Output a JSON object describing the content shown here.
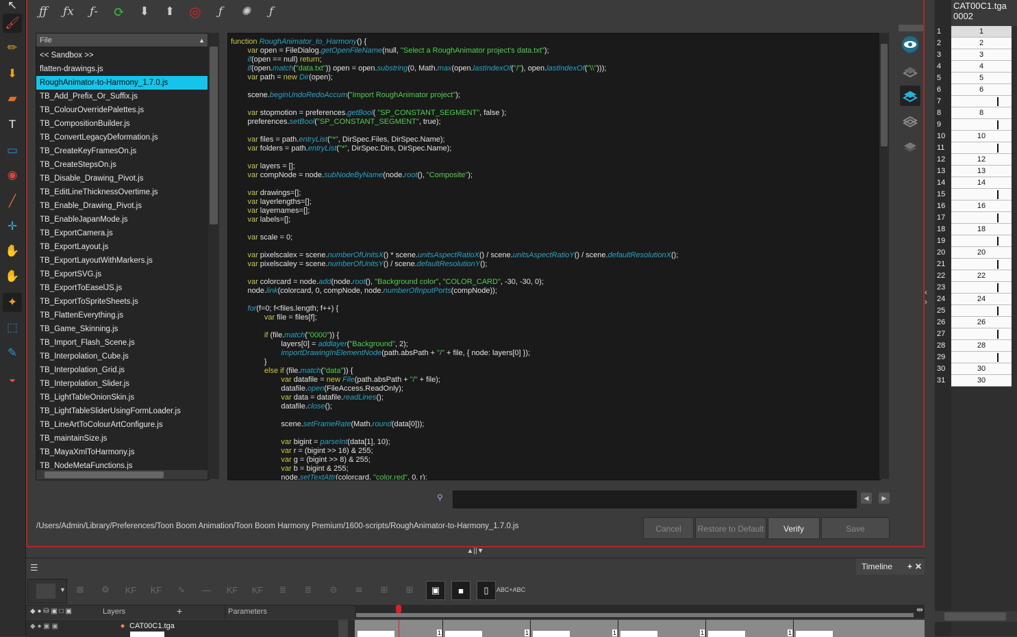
{
  "toolbar_left": {
    "tools": [
      "select-icon",
      "brush-icon",
      "pencil-icon",
      "paint-icon",
      "eraser-icon",
      "text-icon",
      "rectangle-icon",
      "ink-icon",
      "dropper-icon",
      "pivot-icon",
      "hand-icon",
      "zoom-icon",
      "animate-icon",
      "transform-icon",
      "cutter-icon",
      "morph-icon"
    ]
  },
  "script_toolbar": {
    "icons": [
      "manage-functions-icon",
      "new-function-icon",
      "delete-function-icon",
      "refresh-icon",
      "import-script-icon",
      "export-script-icon",
      "target-icon",
      "run-function-icon",
      "debug-icon",
      "set-target-icon"
    ]
  },
  "file_panel": {
    "header": "File",
    "sort_glyph": "▲",
    "files": [
      "<< Sandbox >>",
      "flatten-drawings.js",
      "RoughAnimator-to-Harmony_1.7.0.js",
      "TB_Add_Prefix_Or_Suffix.js",
      "TB_ColourOverridePalettes.js",
      "TB_CompositionBuilder.js",
      "TB_ConvertLegacyDeformation.js",
      "TB_CreateKeyFramesOn.js",
      "TB_CreateStepsOn.js",
      "TB_Disable_Drawing_Pivot.js",
      "TB_EditLineThicknessOvertime.js",
      "TB_Enable_Drawing_Pivot.js",
      "TB_EnableJapanMode.js",
      "TB_ExportCamera.js",
      "TB_ExportLayout.js",
      "TB_ExportLayoutWithMarkers.js",
      "TB_ExportSVG.js",
      "TB_ExportToEaselJS.js",
      "TB_ExportToSpriteSheets.js",
      "TB_FlattenEverything.js",
      "TB_Game_Skinning.js",
      "TB_Import_Flash_Scene.js",
      "TB_Interpolation_Cube.js",
      "TB_Interpolation_Grid.js",
      "TB_Interpolation_Slider.js",
      "TB_LightTableOnionSkin.js",
      "TB_LightTableSliderUsingFormLoader.js",
      "TB_LineArtToColourArtConfigure.js",
      "TB_maintainSize.js",
      "TB_MayaXmlToHarmony.js",
      "TB_NodeMetaFunctions.js"
    ],
    "selected_index": 2
  },
  "code": [
    [
      [
        "kw",
        "function "
      ],
      [
        "fn",
        "RoughAnimator_to_Harmony"
      ],
      [
        "",
        "() {"
      ]
    ],
    [
      [
        "",
        "        "
      ],
      [
        "kw",
        "var "
      ],
      [
        "",
        "open = FileDialog."
      ],
      [
        "fn",
        "getOpenFileName"
      ],
      [
        "",
        "(null, "
      ],
      [
        "st",
        "\"Select a RoughAnimator project's data.txt\""
      ],
      [
        "",
        ");"
      ]
    ],
    [
      [
        "",
        "        "
      ],
      [
        "fn",
        "if"
      ],
      [
        "",
        "(open == null) "
      ],
      [
        "kw",
        "return"
      ],
      [
        "",
        ";"
      ]
    ],
    [
      [
        "",
        "        "
      ],
      [
        "fn",
        "if"
      ],
      [
        "",
        "(open."
      ],
      [
        "fn",
        "match"
      ],
      [
        "",
        "("
      ],
      [
        "st",
        "\"data.txt\""
      ],
      [
        "",
        ")) open = open."
      ],
      [
        "fn",
        "substring"
      ],
      [
        "",
        "(0, Math."
      ],
      [
        "fn",
        "max"
      ],
      [
        "",
        "(open."
      ],
      [
        "fn",
        "lastIndexOf"
      ],
      [
        "",
        "("
      ],
      [
        "st",
        "\"/\""
      ],
      [
        "",
        "), open."
      ],
      [
        "fn",
        "lastIndexOf"
      ],
      [
        "",
        "("
      ],
      [
        "st",
        "\"\\\\\""
      ],
      [
        "",
        ")));"
      ]
    ],
    [
      [
        "",
        "        "
      ],
      [
        "kw",
        "var "
      ],
      [
        "",
        "path = "
      ],
      [
        "kw",
        "new "
      ],
      [
        "fn",
        "Dir"
      ],
      [
        "",
        "(open);"
      ]
    ],
    [
      [
        "",
        ""
      ]
    ],
    [
      [
        "",
        "        scene."
      ],
      [
        "fn",
        "beginUndoRedoAccum"
      ],
      [
        "",
        "("
      ],
      [
        "st",
        "\"Import RoughAnimator project\""
      ],
      [
        "",
        ");"
      ]
    ],
    [
      [
        "",
        ""
      ]
    ],
    [
      [
        "",
        "        "
      ],
      [
        "kw",
        "var "
      ],
      [
        "",
        "stopmotion = preferences."
      ],
      [
        "fn",
        "getBool"
      ],
      [
        "",
        "( "
      ],
      [
        "st",
        "\"SP_CONSTANT_SEGMENT\""
      ],
      [
        "",
        ", false );"
      ]
    ],
    [
      [
        "",
        "        preferences."
      ],
      [
        "fn",
        "setBool"
      ],
      [
        "",
        "("
      ],
      [
        "st",
        "\"SP_CONSTANT_SEGMENT\""
      ],
      [
        "",
        ", true);"
      ]
    ],
    [
      [
        "",
        ""
      ]
    ],
    [
      [
        "",
        "        "
      ],
      [
        "kw",
        "var "
      ],
      [
        "",
        "files = path."
      ],
      [
        "fn",
        "entryList"
      ],
      [
        "",
        "("
      ],
      [
        "st",
        "\"*\""
      ],
      [
        "",
        ", DirSpec.Files, DirSpec.Name);"
      ]
    ],
    [
      [
        "",
        "        "
      ],
      [
        "kw",
        "var "
      ],
      [
        "",
        "folders = path."
      ],
      [
        "fn",
        "entryList"
      ],
      [
        "",
        "("
      ],
      [
        "st",
        "\"*\""
      ],
      [
        "",
        ", DirSpec.Dirs, DirSpec.Name);"
      ]
    ],
    [
      [
        "",
        ""
      ]
    ],
    [
      [
        "",
        "        "
      ],
      [
        "kw",
        "var "
      ],
      [
        "",
        "layers = [];"
      ]
    ],
    [
      [
        "",
        "        "
      ],
      [
        "kw",
        "var "
      ],
      [
        "",
        "compNode = node."
      ],
      [
        "fn",
        "subNodeByName"
      ],
      [
        "",
        "(node."
      ],
      [
        "fn",
        "root"
      ],
      [
        "",
        "(), "
      ],
      [
        "st",
        "\"Composite\""
      ],
      [
        "",
        ");"
      ]
    ],
    [
      [
        "",
        ""
      ]
    ],
    [
      [
        "",
        "        "
      ],
      [
        "kw",
        "var "
      ],
      [
        "",
        "drawings=[];"
      ]
    ],
    [
      [
        "",
        "        "
      ],
      [
        "kw",
        "var "
      ],
      [
        "",
        "layerlengths=[];"
      ]
    ],
    [
      [
        "",
        "        "
      ],
      [
        "kw",
        "var "
      ],
      [
        "",
        "layernames=[];"
      ]
    ],
    [
      [
        "",
        "        "
      ],
      [
        "kw",
        "var "
      ],
      [
        "",
        "labels=[];"
      ]
    ],
    [
      [
        "",
        ""
      ]
    ],
    [
      [
        "",
        "        "
      ],
      [
        "kw",
        "var "
      ],
      [
        "",
        "scale = 0;"
      ]
    ],
    [
      [
        "",
        ""
      ]
    ],
    [
      [
        "",
        "        "
      ],
      [
        "kw",
        "var "
      ],
      [
        "",
        "pixelscalex = scene."
      ],
      [
        "fn",
        "numberOfUnitsX"
      ],
      [
        "",
        "() * scene."
      ],
      [
        "fn",
        "unitsAspectRatioX"
      ],
      [
        "",
        "() / scene."
      ],
      [
        "fn",
        "unitsAspectRatioY"
      ],
      [
        "",
        "() / scene."
      ],
      [
        "fn",
        "defaultResolutionX"
      ],
      [
        "",
        "();"
      ]
    ],
    [
      [
        "",
        "        "
      ],
      [
        "kw",
        "var "
      ],
      [
        "",
        "pixelscaley = scene."
      ],
      [
        "fn",
        "numberOfUnitsY"
      ],
      [
        "",
        "() / scene."
      ],
      [
        "fn",
        "defaultResolutionY"
      ],
      [
        "",
        "();"
      ]
    ],
    [
      [
        "",
        ""
      ]
    ],
    [
      [
        "",
        "        "
      ],
      [
        "kw",
        "var "
      ],
      [
        "",
        "colorcard = node."
      ],
      [
        "fn",
        "add"
      ],
      [
        "",
        "(node."
      ],
      [
        "fn",
        "root"
      ],
      [
        "",
        "(), "
      ],
      [
        "st",
        "\"Background color\""
      ],
      [
        "",
        ", "
      ],
      [
        "st",
        "\"COLOR_CARD\""
      ],
      [
        "",
        ", -30, -30, 0);"
      ]
    ],
    [
      [
        "",
        "        node."
      ],
      [
        "fn",
        "link"
      ],
      [
        "",
        "(colorcard, 0, compNode, node."
      ],
      [
        "fn",
        "numberOfInputPorts"
      ],
      [
        "",
        "(compNode));"
      ]
    ],
    [
      [
        "",
        ""
      ]
    ],
    [
      [
        "",
        "        "
      ],
      [
        "fn",
        "for"
      ],
      [
        "",
        "(f=0; f<files.length; f++) {"
      ]
    ],
    [
      [
        "",
        "                "
      ],
      [
        "kw",
        "var "
      ],
      [
        "",
        "file = files[f];"
      ]
    ],
    [
      [
        "",
        ""
      ]
    ],
    [
      [
        "",
        "                "
      ],
      [
        "kw",
        "if "
      ],
      [
        "",
        "(file."
      ],
      [
        "fn",
        "match"
      ],
      [
        "",
        "("
      ],
      [
        "st",
        "\"0000\""
      ],
      [
        "",
        ")) {"
      ]
    ],
    [
      [
        "",
        "                        layers[0] = "
      ],
      [
        "fn",
        "addlayer"
      ],
      [
        "",
        "("
      ],
      [
        "st",
        "\"Background\""
      ],
      [
        "",
        ", 2);"
      ]
    ],
    [
      [
        "",
        "                        "
      ],
      [
        "fn",
        "importDrawingInElementNode"
      ],
      [
        "",
        "(path.absPath + "
      ],
      [
        "st",
        "\"/\""
      ],
      [
        "",
        " + file, { node: layers[0] });"
      ]
    ],
    [
      [
        "",
        "                }"
      ]
    ],
    [
      [
        "",
        "                "
      ],
      [
        "kw",
        "else if "
      ],
      [
        "",
        "(file."
      ],
      [
        "fn",
        "match"
      ],
      [
        "",
        "("
      ],
      [
        "st",
        "\"data\""
      ],
      [
        "",
        ")) {"
      ]
    ],
    [
      [
        "",
        "                        "
      ],
      [
        "kw",
        "var "
      ],
      [
        "",
        "datafile = "
      ],
      [
        "kw",
        "new "
      ],
      [
        "fn",
        "File"
      ],
      [
        "",
        "(path.absPath + "
      ],
      [
        "st",
        "\"/\""
      ],
      [
        "",
        " + file);"
      ]
    ],
    [
      [
        "",
        "                        datafile."
      ],
      [
        "fn",
        "open"
      ],
      [
        "",
        "(FileAccess.ReadOnly);"
      ]
    ],
    [
      [
        "",
        "                        "
      ],
      [
        "kw",
        "var "
      ],
      [
        "",
        "data = datafile."
      ],
      [
        "fn",
        "readLines"
      ],
      [
        "",
        "();"
      ]
    ],
    [
      [
        "",
        "                        datafile."
      ],
      [
        "fn",
        "close"
      ],
      [
        "",
        "();"
      ]
    ],
    [
      [
        "",
        ""
      ]
    ],
    [
      [
        "",
        "                        scene."
      ],
      [
        "fn",
        "setFrameRate"
      ],
      [
        "",
        "(Math."
      ],
      [
        "fn",
        "round"
      ],
      [
        "",
        "(data[0]));"
      ]
    ],
    [
      [
        "",
        ""
      ]
    ],
    [
      [
        "",
        "                        "
      ],
      [
        "kw",
        "var "
      ],
      [
        "",
        "bigint = "
      ],
      [
        "fn",
        "parseInt"
      ],
      [
        "",
        "(data[1], 10);"
      ]
    ],
    [
      [
        "",
        "                        "
      ],
      [
        "kw",
        "var "
      ],
      [
        "",
        "r = (bigint >> 16) & 255;"
      ]
    ],
    [
      [
        "",
        "                        "
      ],
      [
        "kw",
        "var "
      ],
      [
        "",
        "g = (bigint >> 8) & 255;"
      ]
    ],
    [
      [
        "",
        "                        "
      ],
      [
        "kw",
        "var "
      ],
      [
        "",
        "b = bigint & 255;"
      ]
    ],
    [
      [
        "",
        "                        node."
      ],
      [
        "fn",
        "setTextAttr"
      ],
      [
        "",
        "(colorcard, "
      ],
      [
        "st",
        "\"color.red\""
      ],
      [
        "",
        ", 0, r);"
      ]
    ]
  ],
  "find_bar": {
    "value": "",
    "prev": "◀",
    "next": "▶"
  },
  "path": "/Users/Admin/Library/Preferences/Toon Boom Animation/Toon Boom Harmony Premium/1600-scripts/RoughAnimator-to-Harmony_1.7.0.js",
  "buttons": {
    "cancel": "Cancel",
    "restore": "Restore to Default",
    "verify": "Verify",
    "save": "Save"
  },
  "xsheet": {
    "column_name": "CAT00C1.tga",
    "column_sub": "0002",
    "rows": [
      {
        "n": "1",
        "v": "1"
      },
      {
        "n": "2",
        "v": "2"
      },
      {
        "n": "3",
        "v": "3"
      },
      {
        "n": "4",
        "v": "4"
      },
      {
        "n": "5",
        "v": "5"
      },
      {
        "n": "6",
        "v": "6"
      },
      {
        "n": "7",
        "v": ""
      },
      {
        "n": "8",
        "v": "8"
      },
      {
        "n": "9",
        "v": ""
      },
      {
        "n": "10",
        "v": "10"
      },
      {
        "n": "11",
        "v": ""
      },
      {
        "n": "12",
        "v": "12"
      },
      {
        "n": "13",
        "v": "13"
      },
      {
        "n": "14",
        "v": "14"
      },
      {
        "n": "15",
        "v": ""
      },
      {
        "n": "16",
        "v": "16"
      },
      {
        "n": "17",
        "v": ""
      },
      {
        "n": "18",
        "v": "18"
      },
      {
        "n": "19",
        "v": ""
      },
      {
        "n": "20",
        "v": "20"
      },
      {
        "n": "21",
        "v": ""
      },
      {
        "n": "22",
        "v": "22"
      },
      {
        "n": "23",
        "v": ""
      },
      {
        "n": "24",
        "v": "24"
      },
      {
        "n": "25",
        "v": ""
      },
      {
        "n": "26",
        "v": "26"
      },
      {
        "n": "27",
        "v": ""
      },
      {
        "n": "28",
        "v": "28"
      },
      {
        "n": "29",
        "v": ""
      },
      {
        "n": "30",
        "v": "30"
      },
      {
        "n": "31",
        "v": "30"
      }
    ]
  },
  "timeline": {
    "tab": "Timeline",
    "layers_label": "Layers",
    "params_label": "Parameters",
    "layer_name": "CAT00C1.tga",
    "text_tool_label": "ABC+ABC",
    "frame_marks": [
      "1",
      "1",
      "1",
      "1",
      "1"
    ]
  },
  "colors": {
    "selection": "#15c4ea",
    "frame_border": "#a92a2a",
    "keyword": "#c9c94a",
    "function": "#2aa4c4",
    "string": "#4fcf4f"
  }
}
